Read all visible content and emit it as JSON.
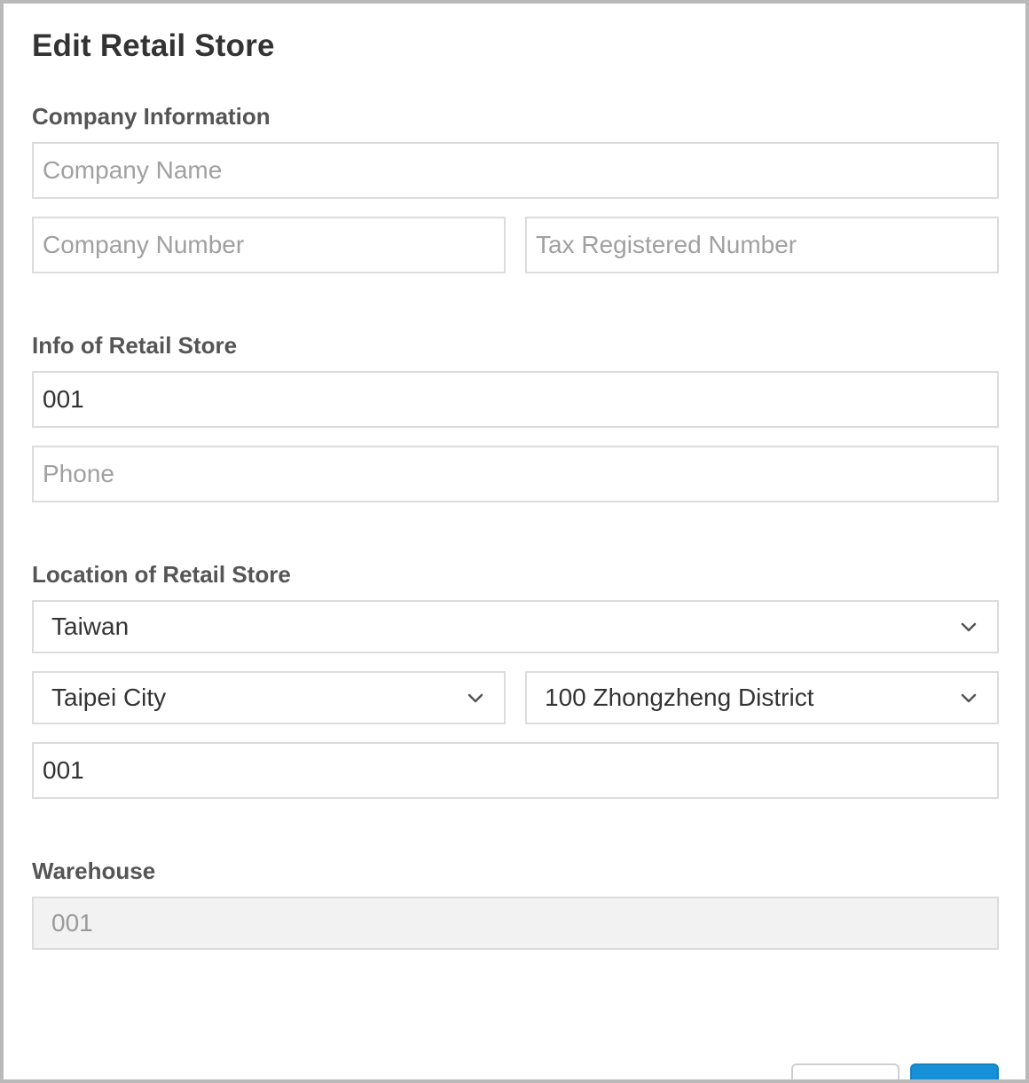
{
  "dialog": {
    "title": "Edit Retail Store"
  },
  "company": {
    "label": "Company Information",
    "name_placeholder": "Company Name",
    "name_value": "",
    "number_placeholder": "Company Number",
    "number_value": "",
    "tax_placeholder": "Tax Registered Number",
    "tax_value": ""
  },
  "store_info": {
    "label": "Info of Retail Store",
    "name_value": "001",
    "phone_placeholder": "Phone",
    "phone_value": ""
  },
  "location": {
    "label": "Location of Retail Store",
    "country": "Taiwan",
    "city": "Taipei City",
    "district": "100 Zhongzheng District",
    "address_value": "001",
    "icons": [
      "chevron-down-icon"
    ]
  },
  "warehouse": {
    "label": "Warehouse",
    "value": "001"
  },
  "footer": {
    "cancel_label": "",
    "ok_label": ""
  },
  "colors": {
    "primary": "#1890d8",
    "border": "#dcdcdc",
    "disabled_bg": "#f2f2f2"
  }
}
